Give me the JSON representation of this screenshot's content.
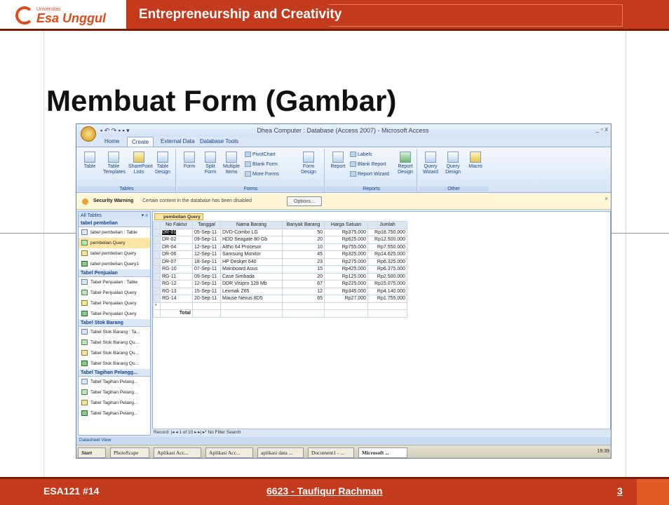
{
  "slide": {
    "logo_small": "Universitas",
    "logo": "Esa Unggul",
    "header": "Entrepreneurship and Creativity",
    "title": "Membuat Form (Gambar)",
    "footer_left": "ESA121 #14",
    "footer_center": "6623 - Taufiqur Rachman",
    "page_number": "3"
  },
  "window": {
    "title": "Dhea Computer : Database (Access 2007) - Microsoft Access",
    "controls": "_ ▫ x"
  },
  "ribbon": {
    "tabs": [
      "Home",
      "Create",
      "External Data",
      "Database Tools"
    ],
    "active_tab": "Create",
    "groups": {
      "tables": {
        "label": "Tables",
        "buttons": [
          "Table",
          "Table Templates",
          "SharePoint Lists",
          "Table Design"
        ]
      },
      "forms": {
        "label": "Forms",
        "buttons": [
          "Form",
          "Split Form",
          "Multiple Items",
          "PivotChart",
          "Blank Form",
          "More Forms",
          "Form Design"
        ]
      },
      "reports": {
        "label": "Reports",
        "buttons": [
          "Report",
          "Labels",
          "Blank Report",
          "Report Wizard",
          "Report Design"
        ]
      },
      "other": {
        "label": "Other",
        "buttons": [
          "Query Wizard",
          "Query Design",
          "Macro"
        ]
      }
    }
  },
  "security_bar": {
    "bold": "Security Warning",
    "text": "Certain content in the database has been disabled",
    "button": "Options..."
  },
  "nav_pane": {
    "header": "All Tables",
    "groups": [
      {
        "name": "tabel pembelian",
        "items": [
          "tabel pembelian : Table",
          "pembelian Query",
          "tabel pembelian Query",
          "tabel pembelian Query1"
        ]
      },
      {
        "name": "Tabel Penjualan",
        "items": [
          "Tabel Penjualan : Table",
          "Tabel Penjualan Query",
          "Tabel Penjualan Query",
          "Tabel Penjualan Query"
        ]
      },
      {
        "name": "Tabel Stok Barang",
        "items": [
          "Tabel Stok Barang : Ta...",
          "Tabel Stok Barang Qu...",
          "Tabel Stok Barang Qu...",
          "Tabel Stok Barang Qu..."
        ]
      },
      {
        "name": "Tabel Tagihan Pelangg...",
        "items": [
          "Tabel Tagihan Pelang...",
          "Tabel Tagihan Pelang...",
          "Tabel Tagihan Pelang...",
          "Tabel Tagihan Pelang..."
        ]
      }
    ]
  },
  "datasheet": {
    "tab": "pembelian Query",
    "columns": [
      "No Faktur",
      "Tanggal",
      "Nama Barang",
      "Banyak Barang",
      "Harga Satuan",
      "Jumlah"
    ],
    "rows": [
      [
        "DR-01",
        "05-Sep-11",
        "DVD-Combo LG",
        "50",
        "Rp375.000",
        "Rp18.750.000"
      ],
      [
        "DR-02",
        "09-Sep-11",
        "HDD Seagate 80 Gb",
        "20",
        "Rp625.000",
        "Rp12.500.000"
      ],
      [
        "DR-04",
        "12-Sep-11",
        "Altho 64 Procesor",
        "10",
        "Rp755.000",
        "Rp7.550.000"
      ],
      [
        "DR-06",
        "12-Sep-11",
        "Samsung Monitor",
        "45",
        "Rp325.000",
        "Rp14.625.000"
      ],
      [
        "DR-07",
        "18-Sep-11",
        "HP Deskjet 640",
        "23",
        "Rp275.000",
        "Rp6.325.000"
      ],
      [
        "RG-10",
        "07-Sep-11",
        "Mainboard Asus",
        "15",
        "Rp425.000",
        "Rp6.375.000"
      ],
      [
        "RG-11",
        "09-Sep-11",
        "Case Simbada",
        "20",
        "Rp125.000",
        "Rp2.500.000"
      ],
      [
        "RG-12",
        "12-Sep-11",
        "DDR Visipro 128 Mb",
        "67",
        "Rp225.000",
        "Rp15.075.000"
      ],
      [
        "RG-13",
        "15-Sep-11",
        "Lexmak Z65",
        "12",
        "Rp345.000",
        "Rp4.140.000"
      ],
      [
        "RG-14",
        "20-Sep-11",
        "Mause Nexus 8D5",
        "65",
        "Rp27.000",
        "Rp1.755.000"
      ]
    ],
    "new_row_marker": "*",
    "total_label": "Total",
    "record_bar": "Record: |◂ ◂ 1 of 10 ▸ ▸| ▸*  No Filter  Search"
  },
  "status": {
    "left": "Datasheet View"
  },
  "taskbar": {
    "start": "Start",
    "items": [
      "PhotoScape",
      "Aplikasi Acc...",
      "Aplikasi Acc...",
      "aplikasi data ...",
      "Document1 - ...",
      "Microsoft ..."
    ],
    "clock": "19:39"
  }
}
